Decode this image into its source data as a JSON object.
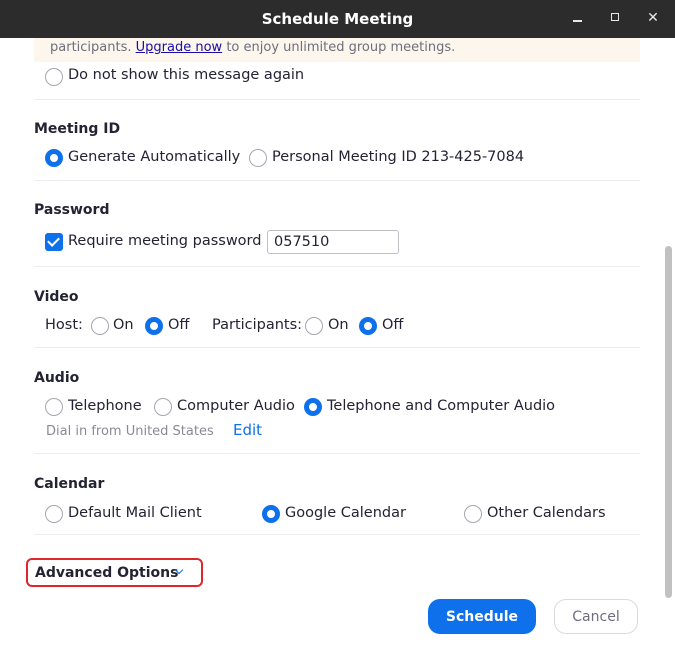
{
  "window": {
    "title": "Schedule Meeting"
  },
  "notice": {
    "text_before": "participants.",
    "link": "Upgrade now",
    "text_after": "to enjoy unlimited group meetings.",
    "dont_show_label": "Do not show this message again"
  },
  "meeting_id": {
    "title": "Meeting ID",
    "generate_label": "Generate Automatically",
    "personal_label": "Personal Meeting ID 213-425-7084",
    "selected": "generate"
  },
  "password": {
    "title": "Password",
    "require_label": "Require meeting password",
    "value": "057510",
    "required": true
  },
  "video": {
    "title": "Video",
    "host_label": "Host:",
    "participants_label": "Participants:",
    "on_label": "On",
    "off_label": "Off",
    "host_value": "Off",
    "participants_value": "Off"
  },
  "audio": {
    "title": "Audio",
    "telephone_label": "Telephone",
    "computer_label": "Computer Audio",
    "both_label": "Telephone and Computer Audio",
    "selected": "both",
    "dial_in_label": "Dial in from United States",
    "edit_label": "Edit"
  },
  "calendar": {
    "title": "Calendar",
    "default_label": "Default Mail Client",
    "google_label": "Google Calendar",
    "other_label": "Other Calendars",
    "selected": "google"
  },
  "advanced": {
    "label": "Advanced Options"
  },
  "actions": {
    "schedule_label": "Schedule",
    "cancel_label": "Cancel"
  },
  "colors": {
    "accent": "#0e71eb",
    "highlight_border": "#e0252b",
    "titlebar": "#2c2c2c"
  }
}
